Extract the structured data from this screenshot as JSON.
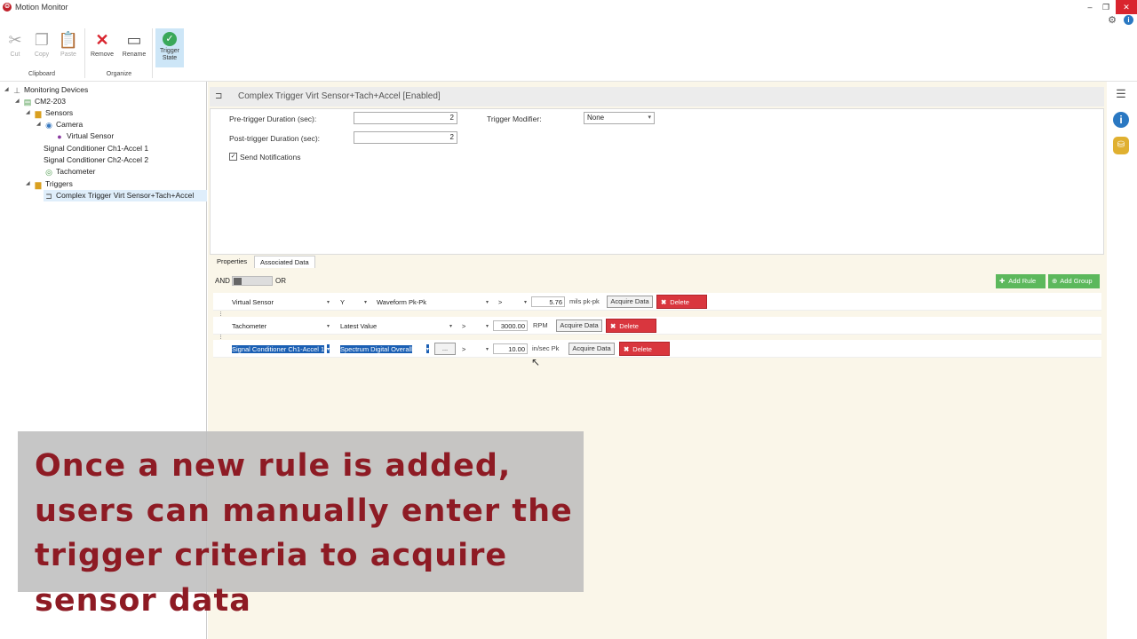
{
  "app": {
    "title": "Motion Monitor",
    "logo_glyph": "❂"
  },
  "window": {
    "minimize": "–",
    "restore": "❐",
    "close": "✕"
  },
  "ribbon": {
    "clipboard": {
      "group_label": "Clipboard",
      "cut": "Cut",
      "copy": "Copy",
      "paste": "Paste"
    },
    "organize": {
      "group_label": "Organize",
      "remove": "Remove",
      "rename": "Rename"
    },
    "trigger_state": "Trigger\nState"
  },
  "tree": {
    "root": "Monitoring Devices",
    "device": "CM2-203",
    "sensors": "Sensors",
    "camera": "Camera",
    "virtual_sensor": "Virtual Sensor",
    "sc1": "Signal Conditioner Ch1-Accel 1",
    "sc2": "Signal Conditioner Ch2-Accel 2",
    "tach": "Tachometer",
    "triggers": "Triggers",
    "complex": "Complex Trigger Virt Sensor+Tach+Accel"
  },
  "header": {
    "title": "Complex Trigger Virt Sensor+Tach+Accel [Enabled]"
  },
  "properties": {
    "pre_label": "Pre-trigger Duration (sec):",
    "pre_value": "2",
    "post_label": "Post-trigger Duration (sec):",
    "post_value": "2",
    "modifier_label": "Trigger Modifier:",
    "modifier_value": "None",
    "notify_label": "Send Notifications",
    "notify_check": "✓"
  },
  "tabs": {
    "properties": "Properties",
    "associated": "Associated Data"
  },
  "rules": {
    "and": "AND",
    "or": "OR",
    "add_rule": "Add Rule",
    "add_group": "Add Group",
    "rows": [
      {
        "source": "Virtual Sensor",
        "axis": "Y",
        "measure": "Waveform Pk-Pk",
        "op": ">",
        "value": "5.76",
        "unit": "mils pk-pk",
        "acquire": "Acquire Data",
        "delete": "Delete"
      },
      {
        "source": "Tachometer",
        "measure": "Latest Value",
        "op": ">",
        "value": "3000.00",
        "unit": "RPM",
        "acquire": "Acquire Data",
        "delete": "Delete"
      },
      {
        "source": "Signal Conditioner Ch1-Accel 1",
        "measure": "Spectrum Digital Overall",
        "more": "...",
        "op": ">",
        "value": "10.00",
        "unit": "in/sec Pk",
        "acquire": "Acquire Data",
        "delete": "Delete"
      }
    ]
  },
  "caption": "Once a new rule is added, users can manually enter the trigger criteria to acquire sensor data",
  "colors": {
    "accent_red": "#d9363e",
    "add_green": "#5cb85c",
    "caption": "#8e1b24"
  }
}
